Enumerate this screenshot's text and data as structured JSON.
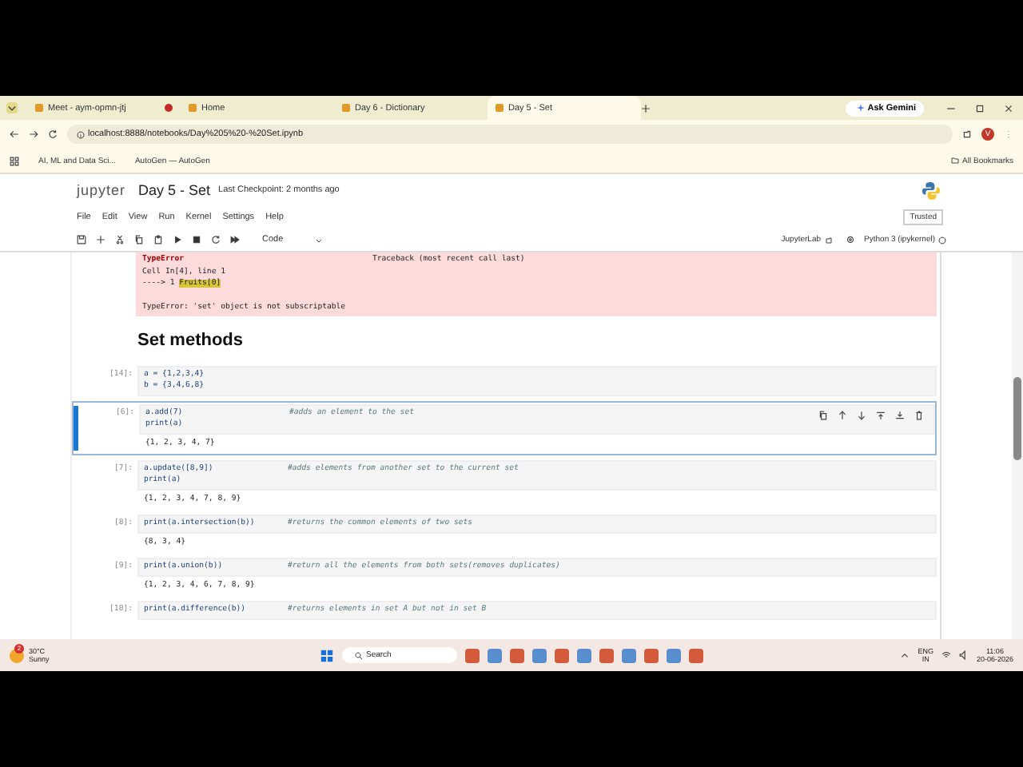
{
  "browser": {
    "tabs": [
      {
        "label": "Meet - aym-opmn-jtj",
        "selected": false,
        "recording": true
      },
      {
        "label": "Home",
        "selected": false,
        "recording": false
      },
      {
        "label": "Day 6 - Dictionary",
        "selected": false,
        "recording": false
      },
      {
        "label": "Day 5 - Set",
        "selected": true,
        "recording": false
      }
    ],
    "gemini": "Ask Gemini",
    "address": "localhost:8888/notebooks/Day%205%20-%20Set.ipynb",
    "profile": "V",
    "bookmarks": [
      "AI, ML and Data Sci...",
      "AutoGen — AutoGen"
    ],
    "all_bookmarks": "All Bookmarks"
  },
  "jupyter": {
    "logo": "jupyter",
    "title": "Day 5 - Set",
    "checkpoint": "Last Checkpoint: 2 months ago",
    "trusted": "Trusted",
    "menu": [
      "File",
      "Edit",
      "View",
      "Run",
      "Kernel",
      "Settings",
      "Help"
    ],
    "cell_type": "Code",
    "lab": "JupyterLab",
    "kernel": "Python 3 (ipykernel)"
  },
  "cells": [
    {
      "kind": "error",
      "lines": [
        [
          "TypeError",
          "Traceback (most recent call last)"
        ],
        [
          "Cell In[4], line 1"
        ],
        [
          "----> 1 ",
          "Fruits[0]"
        ]
      ],
      "message": "TypeError: 'set' object is not subscriptable"
    },
    {
      "kind": "heading",
      "text": "Set methods"
    },
    {
      "kind": "code",
      "prompt": "[14]:",
      "selected": false,
      "code": [
        {
          "code": "a = {1,2,3,4}"
        },
        {
          "code": "b = {3,4,6,8}"
        }
      ]
    },
    {
      "kind": "code",
      "prompt": "[6]:",
      "selected": true,
      "code": [
        {
          "code": "a.add(7)",
          "comment": "#adds an element to the set"
        },
        {
          "code": "print(a)"
        }
      ],
      "output": "{1, 2, 3, 4, 7}"
    },
    {
      "kind": "code",
      "prompt": "[7]:",
      "selected": false,
      "code": [
        {
          "code": "a.update([8,9])",
          "comment": "#adds elements from another set to the current set"
        },
        {
          "code": "print(a)"
        }
      ],
      "output": "{1, 2, 3, 4, 7, 8, 9}"
    },
    {
      "kind": "code",
      "prompt": "[8]:",
      "selected": false,
      "code": [
        {
          "code": "print(a.intersection(b))",
          "comment": "#returns the common elements of two sets"
        }
      ],
      "output": "{8, 3, 4}"
    },
    {
      "kind": "code",
      "prompt": "[9]:",
      "selected": false,
      "code": [
        {
          "code": "print(a.union(b))",
          "comment": "#return all the elements from both sets(removes duplicates)"
        }
      ],
      "output": "{1, 2, 3, 4, 6, 7, 8, 9}"
    },
    {
      "kind": "code",
      "prompt": "[10]:",
      "selected": false,
      "code": [
        {
          "code": "print(a.difference(b))",
          "comment": "#returns elements in set A but not in set B"
        }
      ]
    }
  ],
  "taskbar": {
    "weather_badge": "2",
    "temperature": "30°C",
    "condition": "Sunny",
    "search": "Search",
    "language": "ENG",
    "region": "IN",
    "time": "11:06",
    "date": "20-06-2026"
  }
}
